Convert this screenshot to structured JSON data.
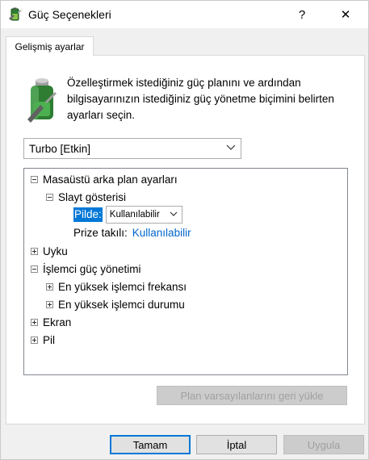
{
  "window": {
    "title": "Güç Seçenekleri",
    "help_glyph": "?",
    "close_glyph": "✕"
  },
  "tab": {
    "label": "Gelişmiş ayarlar"
  },
  "description": "Özelleştirmek istediğiniz güç planını ve ardından bilgisayarınızın istediğiniz güç yönetme biçimini belirten ayarları seçin.",
  "plan_select": {
    "value": "Turbo [Etkin]"
  },
  "tree": {
    "items": [
      {
        "label": "Masaüstü arka plan ayarları",
        "state": "expanded"
      },
      {
        "label": "Slayt gösterisi",
        "state": "expanded"
      },
      {
        "label": "Pilde:",
        "value": "Kullanılabilir"
      },
      {
        "label": "Prize takılı:",
        "value": "Kullanılabilir"
      },
      {
        "label": "Uyku",
        "state": "collapsed"
      },
      {
        "label": "İşlemci güç yönetimi",
        "state": "expanded"
      },
      {
        "label": "En yüksek işlemci frekansı",
        "state": "collapsed"
      },
      {
        "label": "En yüksek işlemci durumu",
        "state": "collapsed"
      },
      {
        "label": "Ekran",
        "state": "collapsed"
      },
      {
        "label": "Pil",
        "state": "collapsed"
      }
    ]
  },
  "buttons": {
    "restore": "Plan varsayılanlarını geri yükle",
    "ok": "Tamam",
    "cancel": "İptal",
    "apply": "Uygula"
  },
  "colors": {
    "accent": "#0078d7",
    "link": "#0066cc"
  }
}
